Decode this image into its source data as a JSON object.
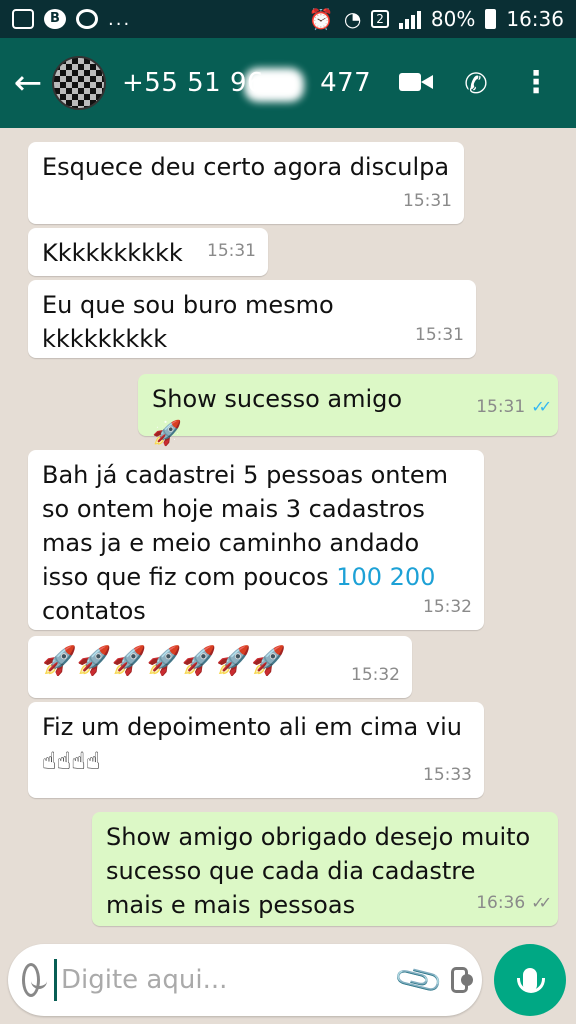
{
  "status_bar": {
    "battery": "80%",
    "time": "16:36",
    "sim": "2",
    "dots": "..."
  },
  "header": {
    "contact_prefix": "+55 51 96",
    "contact_suffix": "477",
    "icons": [
      "back-arrow-icon",
      "video-call-icon",
      "phone-icon",
      "more-options-icon"
    ]
  },
  "messages": [
    {
      "dir": "in",
      "text": "Esquece deu certo agora disculpa",
      "time": "15:31"
    },
    {
      "dir": "in",
      "text": "Kkkkkkkkkk",
      "time": "15:31"
    },
    {
      "dir": "in",
      "text": "Eu que sou buro mesmo kkkkkkkkk",
      "time": "15:31"
    },
    {
      "dir": "out",
      "text": "Show sucesso amigo 🚀",
      "time": "15:31",
      "status": "read"
    },
    {
      "dir": "in",
      "text": "Bah já cadastrei 5 pessoas ontem\nso ontem hoje mais 3 cadastros\nmas ja e meio caminho andado\nisso que fiz com poucos ",
      "link_text": "100 200",
      "text_after": "\ncontatos",
      "time": "15:32"
    },
    {
      "dir": "in",
      "text": "🚀🚀🚀🚀🚀🚀🚀",
      "time": "15:32"
    },
    {
      "dir": "in",
      "text": "Fiz um depoimento ali em cima viu\n☝☝☝☝",
      "time": "15:33"
    },
    {
      "dir": "out",
      "text": "Show amigo obrigado desejo muito\nsucesso que cada dia cadastre\nmais e mais pessoas",
      "time": "16:36",
      "status": "delivered"
    }
  ],
  "input": {
    "placeholder": "Digite aqui..."
  },
  "colors": {
    "header": "#075e54",
    "status_bar": "#0a2f34",
    "outgoing": "#dcf8c6",
    "incoming": "#ffffff",
    "background": "#e5ddd5",
    "read_ticks": "#34b7f1",
    "mic_button": "#00a884"
  }
}
